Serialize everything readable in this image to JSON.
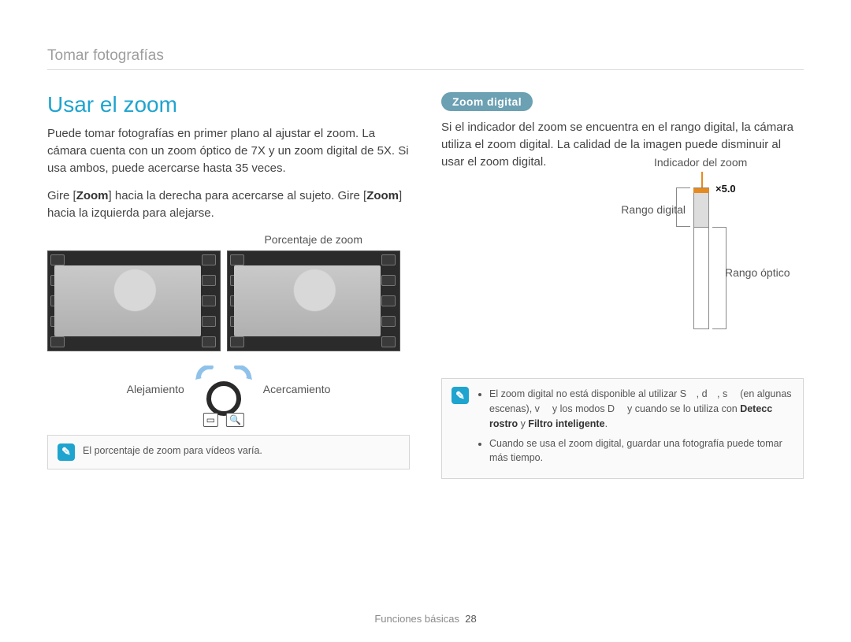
{
  "breadcrumb": "Tomar fotografías",
  "left": {
    "heading": "Usar el zoom",
    "p1": "Puede tomar fotografías en primer plano al ajustar el zoom. La cámara cuenta con un zoom óptico de 7X y un zoom digital de 5X. Si usa ambos, puede acercarse hasta 35 veces.",
    "p2a": "Gire [",
    "p2b": "Zoom",
    "p2c": "] hacia la derecha para acercarse al sujeto. Gire [",
    "p2d": "Zoom",
    "p2e": "] hacia la izquierda para alejarse.",
    "zoom_pct_label": "Porcentaje de zoom",
    "zoom_out_label": "Alejamiento",
    "zoom_in_label": "Acercamiento",
    "note": "El porcentaje de zoom para vídeos varía."
  },
  "right": {
    "pill": "Zoom digital",
    "p1": "Si el indicador del zoom se encuentra en el rango digital, la cámara utiliza el zoom digital. La calidad de la imagen puede disminuir al usar el zoom digital.",
    "indicator_label": "Indicador del zoom",
    "range_digital": "Rango digital",
    "range_optical": "Rango óptico",
    "x5": "×5.0",
    "note_li1a": "El zoom digital no está disponible al utilizar S , d , s  (en algunas escenas), v  y los modos D  y cuando se lo utiliza con ",
    "note_li1b": "Detecc rostro",
    "note_li1c": " y ",
    "note_li1d": "Filtro inteligente",
    "note_li1e": ".",
    "note_li2": "Cuando se usa el zoom digital, guardar una fotografía puede tomar más tiempo."
  },
  "footer_section": "Funciones básicas",
  "footer_page": "28"
}
